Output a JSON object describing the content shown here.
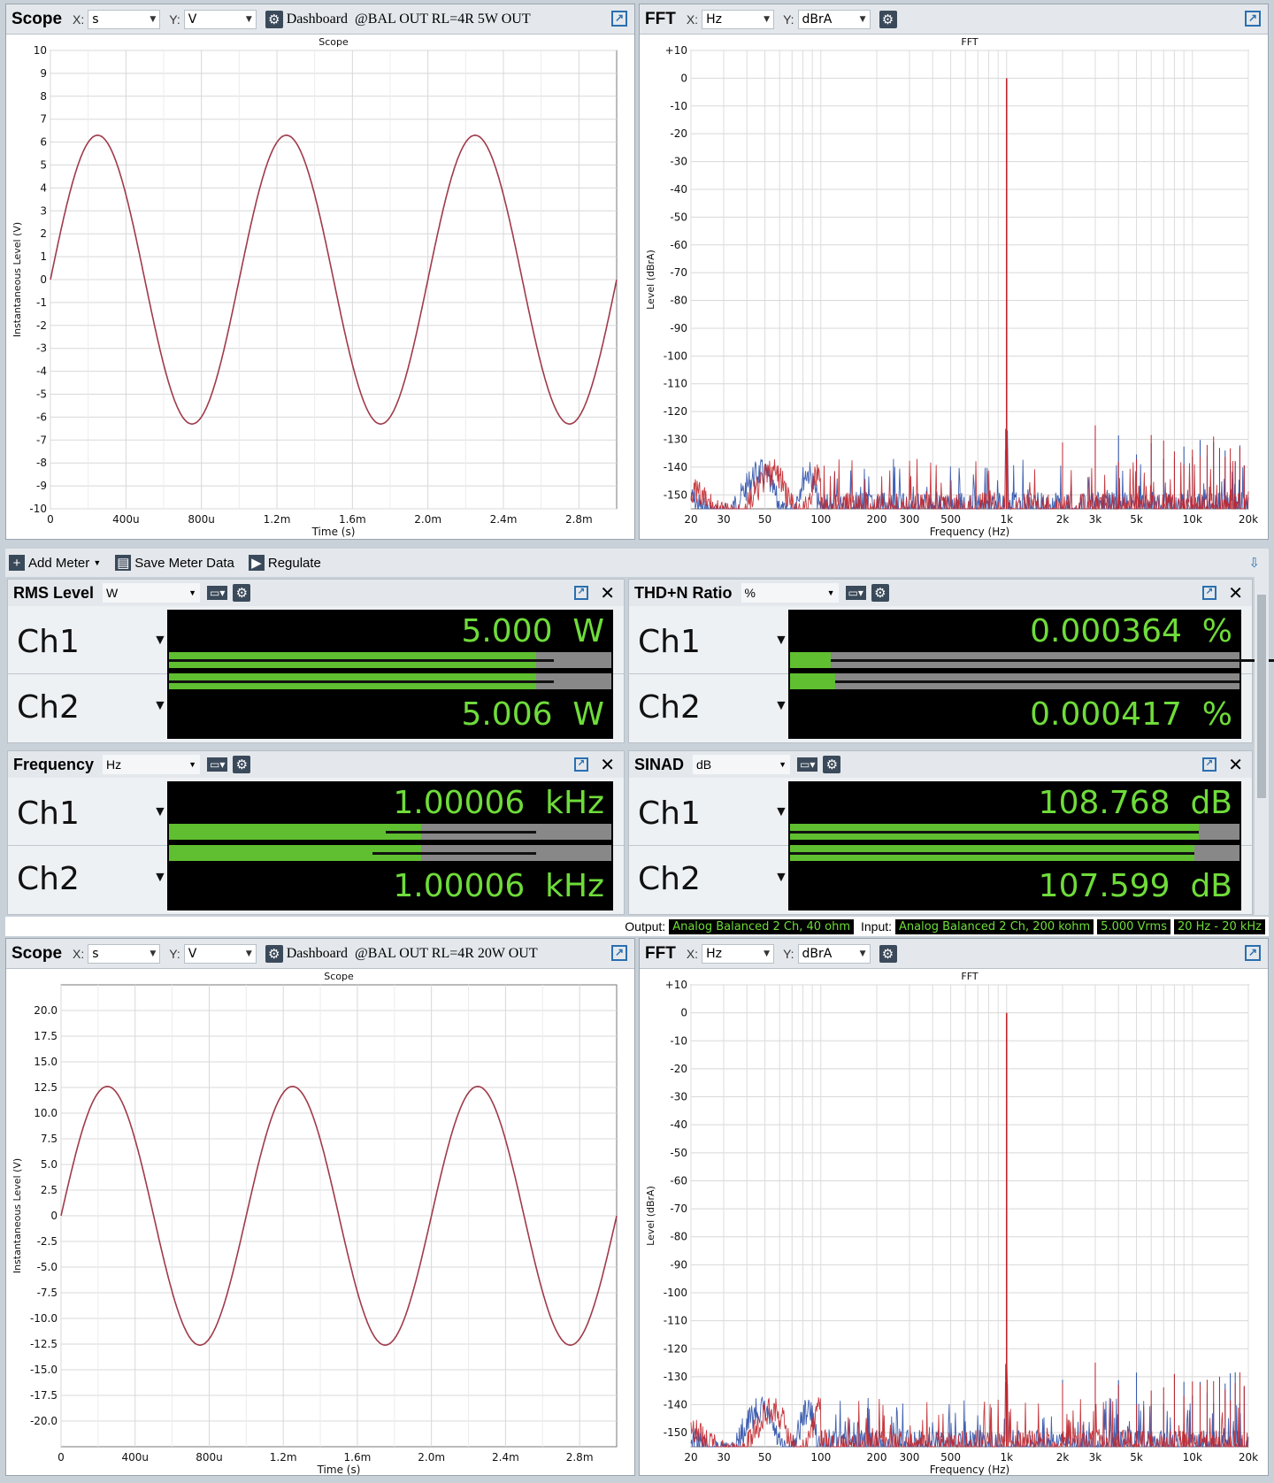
{
  "scope1": {
    "title": "Scope",
    "x_label": "X:",
    "x_unit": "s",
    "y_label": "Y:",
    "y_unit": "V",
    "dashboard": "Dashboard",
    "caption": "@BAL OUT RL=4R 5W OUT",
    "chart_title": "Scope",
    "xlabel": "Time (s)",
    "ylabel": "Instantaneous Level (V)"
  },
  "fft1": {
    "title": "FFT",
    "x_label": "X:",
    "x_unit": "Hz",
    "y_label": "Y:",
    "y_unit": "dBrA",
    "chart_title": "FFT",
    "xlabel": "Frequency (Hz)",
    "ylabel": "Level (dBrA)"
  },
  "scope2": {
    "title": "Scope",
    "x_label": "X:",
    "x_unit": "s",
    "y_label": "Y:",
    "y_unit": "V",
    "dashboard": "Dashboard",
    "caption": "@BAL OUT RL=4R 20W OUT",
    "chart_title": "Scope",
    "xlabel": "Time (s)",
    "ylabel": "Instantaneous Level (V)"
  },
  "fft2": {
    "title": "FFT",
    "x_label": "X:",
    "x_unit": "Hz",
    "y_label": "Y:",
    "y_unit": "dBrA",
    "chart_title": "FFT",
    "xlabel": "Frequency (Hz)",
    "ylabel": "Level (dBrA)"
  },
  "toolbar": {
    "add_meter": "Add Meter",
    "save": "Save Meter Data",
    "regulate": "Regulate"
  },
  "meters": {
    "rms": {
      "name": "RMS Level",
      "unit": "W",
      "ch1_label": "Ch1",
      "ch2_label": "Ch2",
      "ch1_value": "5.000",
      "ch2_value": "5.006",
      "ch1_fill": 0.83,
      "ch2_fill": 0.83
    },
    "thd": {
      "name": "THD+N Ratio",
      "unit": "%",
      "ch1_label": "Ch1",
      "ch2_label": "Ch2",
      "ch1_value": "0.000364",
      "ch2_value": "0.000417",
      "ch1_fill": 0.09,
      "ch2_fill": 0.1
    },
    "freq": {
      "name": "Frequency",
      "unit": "Hz",
      "ch1_label": "Ch1",
      "ch2_label": "Ch2",
      "ch1_value": "1.00006",
      "ch2_value": "1.00006",
      "value_unit": "kHz",
      "ch1_fill": 0.57,
      "ch2_fill": 0.57
    },
    "sinad": {
      "name": "SINAD",
      "unit": "dB",
      "ch1_label": "Ch1",
      "ch2_label": "Ch2",
      "ch1_value": "108.768",
      "ch2_value": "107.599",
      "value_unit": "dB",
      "ch1_fill": 0.91,
      "ch2_fill": 0.9
    }
  },
  "status": {
    "output_label": "Output:",
    "output_value": "Analog Balanced 2 Ch, 40 ohm",
    "input_label": "Input:",
    "input_value": "Analog Balanced 2 Ch, 200 kohm",
    "level": "5.000 Vrms",
    "bandwidth": "20 Hz - 20 kHz"
  },
  "chart_data": [
    {
      "type": "line",
      "title": "Scope",
      "xlabel": "Time (s)",
      "ylabel": "Instantaneous Level (V)",
      "x_ticks": [
        "0",
        "400u",
        "800u",
        "1.2m",
        "1.6m",
        "2.0m",
        "2.4m",
        "2.8m"
      ],
      "xlim": [
        0,
        0.003
      ],
      "ylim": [
        -10,
        10
      ],
      "y_ticks": [
        "10",
        "9",
        "8",
        "7",
        "6",
        "5",
        "4",
        "3",
        "2",
        "1",
        "0",
        "-1",
        "-2",
        "-3",
        "-4",
        "-5",
        "-6",
        "-7",
        "-8",
        "-9",
        "-10"
      ],
      "series": [
        {
          "amplitude": 6.3,
          "frequency_hz": 1000
        }
      ]
    },
    {
      "type": "line",
      "title": "FFT",
      "xlabel": "Frequency (Hz)",
      "ylabel": "Level (dBrA)",
      "log_x": true,
      "xlim": [
        20,
        20000
      ],
      "ylim": [
        -155,
        10
      ],
      "x_ticks": [
        "20",
        "30",
        "50",
        "100",
        "200",
        "300",
        "500",
        "1k",
        "2k",
        "3k",
        "5k",
        "10k",
        "20k"
      ],
      "y_ticks": [
        "+10",
        "0",
        "-10",
        "-20",
        "-30",
        "-40",
        "-50",
        "-60",
        "-70",
        "-80",
        "-90",
        "-100",
        "-110",
        "-120",
        "-130",
        "-140",
        "-150"
      ],
      "series": [
        {
          "fundamental_hz": 1000,
          "peak": 0,
          "noise_floor": -145
        }
      ]
    },
    {
      "type": "line",
      "title": "Scope",
      "xlabel": "Time (s)",
      "ylabel": "Instantaneous Level (V)",
      "x_ticks": [
        "0",
        "400u",
        "800u",
        "1.2m",
        "1.6m",
        "2.0m",
        "2.4m",
        "2.8m"
      ],
      "xlim": [
        0,
        0.003
      ],
      "ylim": [
        -22.5,
        22.5
      ],
      "y_ticks": [
        "20.0",
        "17.5",
        "15.0",
        "12.5",
        "10.0",
        "7.5",
        "5.0",
        "2.5",
        "0",
        "-2.5",
        "-5.0",
        "-7.5",
        "-10.0",
        "-12.5",
        "-15.0",
        "-17.5",
        "-20.0"
      ],
      "series": [
        {
          "amplitude": 12.6,
          "frequency_hz": 1000
        }
      ]
    },
    {
      "type": "line",
      "title": "FFT",
      "xlabel": "Frequency (Hz)",
      "ylabel": "Level (dBrA)",
      "log_x": true,
      "xlim": [
        20,
        20000
      ],
      "ylim": [
        -155,
        10
      ],
      "x_ticks": [
        "20",
        "30",
        "50",
        "100",
        "200",
        "300",
        "500",
        "1k",
        "2k",
        "3k",
        "5k",
        "10k",
        "20k"
      ],
      "y_ticks": [
        "+10",
        "0",
        "-10",
        "-20",
        "-30",
        "-40",
        "-50",
        "-60",
        "-70",
        "-80",
        "-90",
        "-100",
        "-110",
        "-120",
        "-130",
        "-140",
        "-150"
      ],
      "series": [
        {
          "fundamental_hz": 1000,
          "peak": 0,
          "noise_floor": -145
        }
      ]
    }
  ],
  "colors": {
    "ch1": "#2b4fa8",
    "ch2": "#c0262c",
    "scope_trace": "#a03a4a",
    "meter_text": "#6fdc3a",
    "bar_fill": "#5fbf30"
  }
}
